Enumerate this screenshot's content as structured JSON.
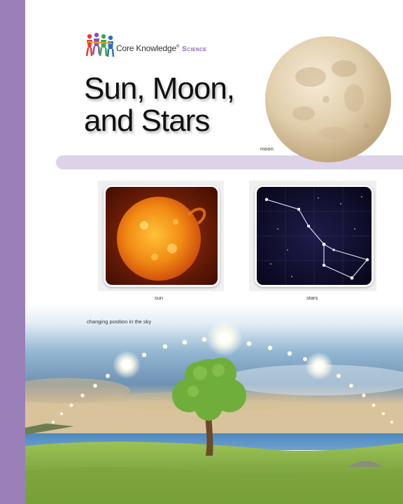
{
  "header": {
    "brand": "Core Knowledge",
    "brand_mark": "®",
    "subject": "Science",
    "logo_icon": "four-children-holding-hands-logo"
  },
  "title": {
    "line1": "Sun, Moon,",
    "line2": "and Stars"
  },
  "captions": {
    "moon": "moon",
    "sun": "sun",
    "stars": "stars",
    "sky": "changing position in the sky"
  },
  "colors": {
    "side_bar": "#9b7fb8",
    "band": "#dcd3e8",
    "brand_purple": "#8f6bb6"
  }
}
